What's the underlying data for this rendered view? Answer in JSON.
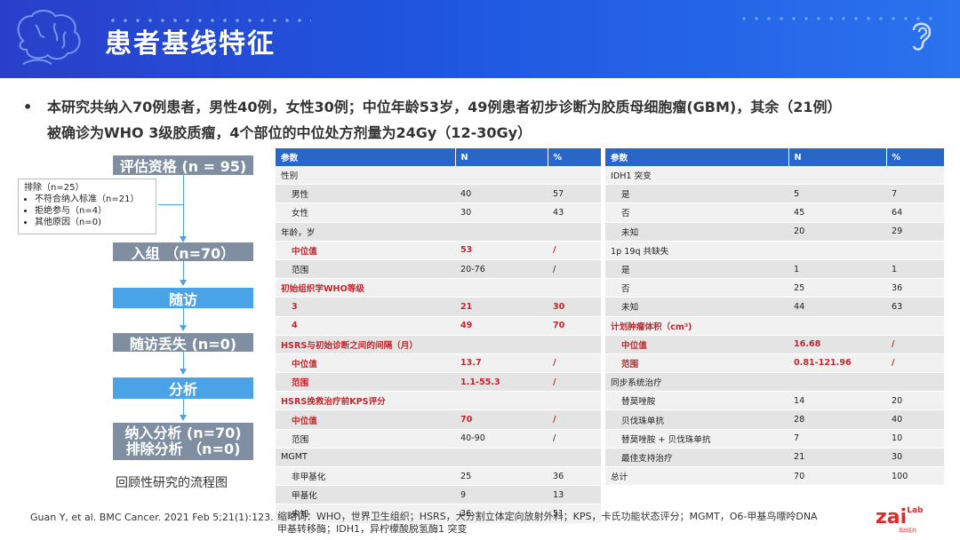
{
  "header": {
    "title": "患者基线特征"
  },
  "bullet": {
    "marker": "•",
    "line1": "本研究共纳入70例患者，男性40例，女性30例；中位年龄53岁，49例患者初步诊断为胶质母细胞瘤(GBM)，其余（21例）",
    "line2": "被确诊为WHO 3级胶质瘤，4个部位的中位处方剂量为24Gy（12-30Gy）"
  },
  "flow": {
    "step1": "评估资格 (n = 95)",
    "exclude": {
      "title": "排除（n=25）",
      "items": [
        "不符合纳入标准（n=21）",
        "拒绝参与（n=4）",
        "其他原因（n=0)"
      ]
    },
    "step2": "入组 （n=70）",
    "step3": "随访",
    "step4": "随访丢失 (n=0)",
    "step5": "分析",
    "step6_line1": "纳入分析 (n=70)",
    "step6_line2": "排除分析 （n=0)",
    "caption": "回顾性研究的流程图"
  },
  "citation": "Guan Y, et al. BMC Cancer. 2021 Feb 5;21(1):123.",
  "left_table": {
    "headers": [
      "参数",
      "N",
      "%"
    ],
    "rows": [
      {
        "cells": [
          "性别",
          "",
          ""
        ],
        "style": "section"
      },
      {
        "cells": [
          "男性",
          "40",
          "57"
        ],
        "style": "indent"
      },
      {
        "cells": [
          "女性",
          "30",
          "43"
        ],
        "style": "indent"
      },
      {
        "cells": [
          "年龄，岁",
          "",
          ""
        ],
        "style": "section"
      },
      {
        "cells": [
          "中位值",
          "53",
          "/"
        ],
        "style": "indent-red"
      },
      {
        "cells": [
          "范围",
          "20-76",
          "/"
        ],
        "style": "indent"
      },
      {
        "cells": [
          "初始组织学WHO等级",
          "",
          ""
        ],
        "style": "section-red"
      },
      {
        "cells": [
          "3",
          "21",
          "30"
        ],
        "style": "indent-red"
      },
      {
        "cells": [
          "4",
          "49",
          "70"
        ],
        "style": "indent-red"
      },
      {
        "cells": [
          "HSRS与初始诊断之间的间隔（月）",
          "",
          ""
        ],
        "style": "section-red"
      },
      {
        "cells": [
          "中位值",
          "13.7",
          "/"
        ],
        "style": "indent-red"
      },
      {
        "cells": [
          "范围",
          "1.1-55.3",
          "/"
        ],
        "style": "indent-red"
      },
      {
        "cells": [
          "HSRS挽救治疗前KPS评分",
          "",
          ""
        ],
        "style": "section-red"
      },
      {
        "cells": [
          "中位值",
          "70",
          "/"
        ],
        "style": "indent-red"
      },
      {
        "cells": [
          "范围",
          "40-90",
          "/"
        ],
        "style": "indent"
      },
      {
        "cells": [
          "MGMT",
          "",
          ""
        ],
        "style": "section"
      },
      {
        "cells": [
          "非甲基化",
          "25",
          "36"
        ],
        "style": "indent"
      },
      {
        "cells": [
          "甲基化",
          "9",
          "13"
        ],
        "style": "indent"
      },
      {
        "cells": [
          "未知",
          "36",
          "51"
        ],
        "style": "indent"
      }
    ]
  },
  "right_table": {
    "headers": [
      "参数",
      "N",
      "%"
    ],
    "rows": [
      {
        "cells": [
          "IDH1 突变",
          "",
          ""
        ],
        "style": "section"
      },
      {
        "cells": [
          "是",
          "5",
          "7"
        ],
        "style": "indent"
      },
      {
        "cells": [
          "否",
          "45",
          "64"
        ],
        "style": "indent"
      },
      {
        "cells": [
          "未知",
          "20",
          "29"
        ],
        "style": "indent"
      },
      {
        "cells": [
          "1p 19q 共缺失",
          "",
          ""
        ],
        "style": "section"
      },
      {
        "cells": [
          "是",
          "1",
          "1"
        ],
        "style": "indent"
      },
      {
        "cells": [
          "否",
          "25",
          "36"
        ],
        "style": "indent"
      },
      {
        "cells": [
          "未知",
          "44",
          "63"
        ],
        "style": "indent"
      },
      {
        "cells": [
          "计划肿瘤体积（cm³)",
          "",
          ""
        ],
        "style": "section-red"
      },
      {
        "cells": [
          "中位值",
          "16.68",
          "/"
        ],
        "style": "indent-red"
      },
      {
        "cells": [
          "范围",
          "0.81-121.96",
          "/"
        ],
        "style": "indent-red"
      },
      {
        "cells": [
          "同步系统治疗",
          "",
          ""
        ],
        "style": "section"
      },
      {
        "cells": [
          "替莫唑胺",
          "14",
          "20"
        ],
        "style": "indent"
      },
      {
        "cells": [
          "贝伐珠单抗",
          "28",
          "40"
        ],
        "style": "indent"
      },
      {
        "cells": [
          "替莫唑胺 + 贝伐珠单抗",
          "7",
          "10"
        ],
        "style": "indent"
      },
      {
        "cells": [
          "最佳支持治疗",
          "21",
          "30"
        ],
        "style": "indent"
      },
      {
        "cells": [
          "总计",
          "70",
          "100"
        ],
        "style": "section"
      }
    ]
  },
  "footnote": {
    "line1": "缩略词：WHO，世界卫生组织；HSRS，大分割立体定向放射外科；KPS，卡氏功能状态评分；MGMT，O6-甲基鸟嘌呤DNA",
    "line2": "甲基转移酶；IDH1，异柠檬酸脱氢酶1 突变"
  },
  "logo": {
    "text": "zai",
    "lab": "Lab",
    "sub": "再鼎医药"
  },
  "colors": {
    "header_blue": "#1f56e0",
    "table_header": "#2867c5",
    "flow_gray": "#7f8ea0",
    "flow_blue": "#4aa3e6",
    "highlight_red": "#c0282d"
  }
}
